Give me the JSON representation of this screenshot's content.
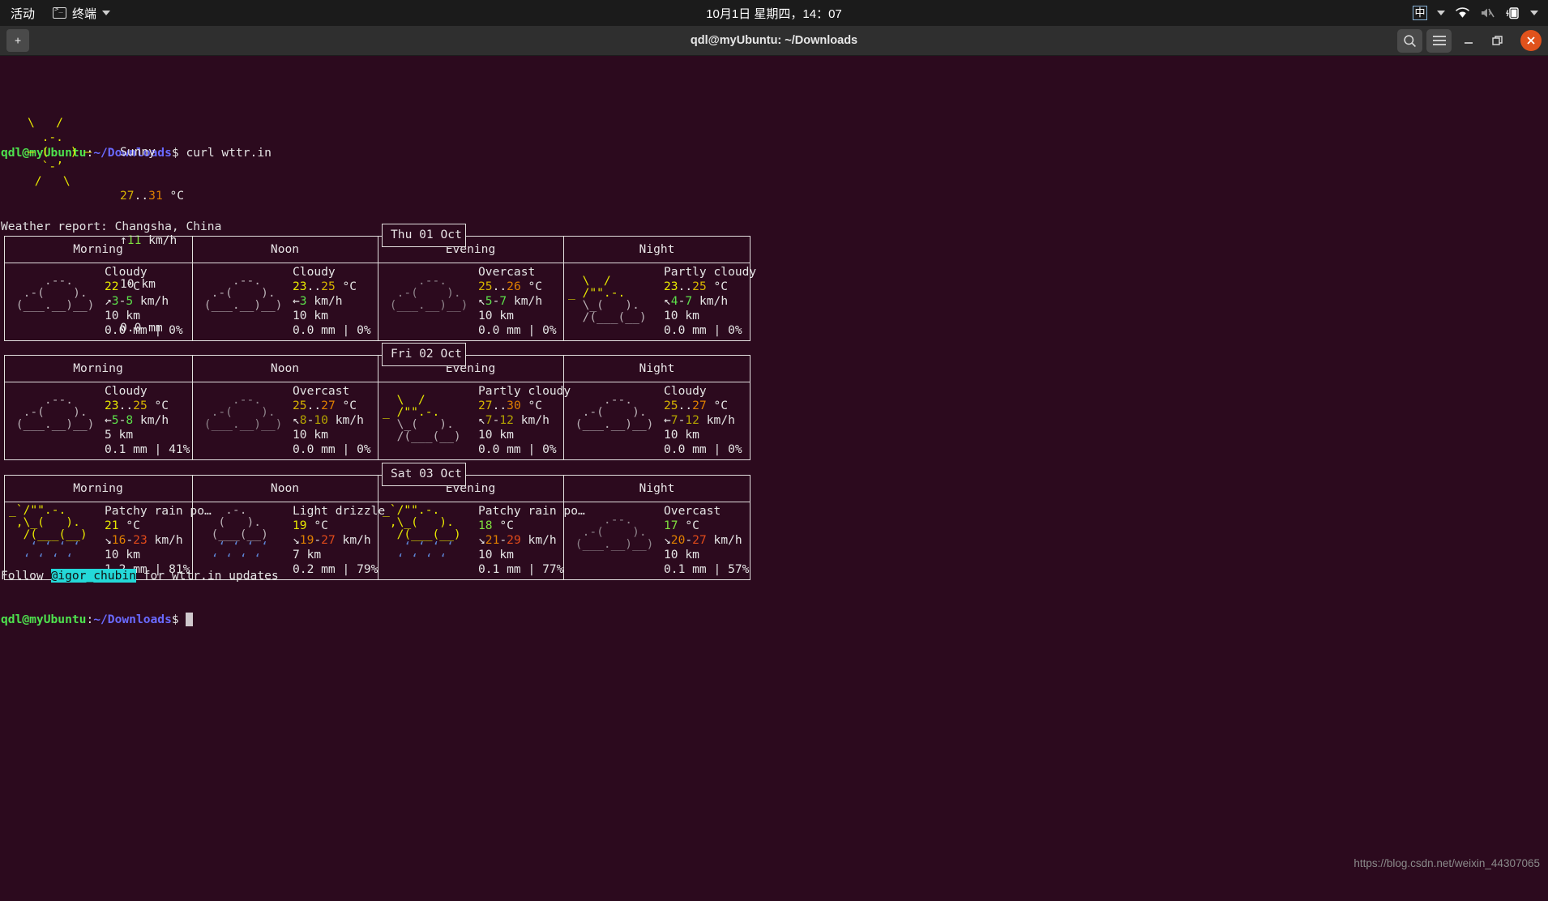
{
  "topbar": {
    "activities": "活动",
    "app_menu": "终端",
    "clock": "10月1日 星期四，14：07",
    "ime": "中",
    "icons": [
      "terminal-icon",
      "chevron-down-icon",
      "wifi-icon",
      "volume-muted-icon",
      "battery-icon",
      "chevron-down-icon"
    ]
  },
  "window": {
    "title": "qdl@myUbuntu: ~/Downloads",
    "new_tab": "+",
    "search": "⌕",
    "menu": "☰",
    "minimize": "—",
    "maximize": "❐",
    "close": "✕"
  },
  "terminal": {
    "prompt_user": "qdl@myUbuntu",
    "prompt_colon": ":",
    "prompt_path": "~/Downloads",
    "prompt_sym": "$ ",
    "command": "curl wttr.in",
    "report_line": "Weather report: Changsha, China",
    "footer_pre": "Follow ",
    "footer_handle": "@igor_chubin",
    "footer_post": " for wttr.in updates"
  },
  "current": {
    "art": [
      "\\   /",
      "  .-.",
      "― (   ) ―",
      "  `-’",
      " /   \\"
    ],
    "condition": "Sunny",
    "temp_lo": "27",
    "temp_sep": "..",
    "temp_hi": "31",
    "temp_unit": " °C",
    "wind_arrow": "↑",
    "wind": "11",
    "wind_unit": " km/h",
    "visibility": "10 km",
    "precip": "0.0 mm"
  },
  "columns": [
    "Morning",
    "Noon",
    "Evening",
    "Night"
  ],
  "days": [
    {
      "label": "Thu 01 Oct",
      "cells": [
        {
          "art": [
            "     .--.",
            "  .-(    ).",
            " (___.__)__)"
          ],
          "art_color": "gray",
          "condition": "Cloudy",
          "temp": "22",
          "temp2": "",
          "unit": " °C",
          "arrow": "↗",
          "wind_lo": "3",
          "wind_sep": "-",
          "wind_hi": "5",
          "wind_unit": " km/h",
          "vis": "10 km",
          "precip": "0.0 mm | 0%",
          "temp_cls": "yellow",
          "wind_cls": "green"
        },
        {
          "art": [
            "     .--.",
            "  .-(    ).",
            " (___.__)__)"
          ],
          "art_color": "gray",
          "condition": "Cloudy",
          "temp": "23",
          "temp2": "25",
          "unit": " °C",
          "arrow": "←",
          "wind_lo": "3",
          "wind_sep": "",
          "wind_hi": "",
          "wind_unit": " km/h",
          "vis": "10 km",
          "precip": "0.0 mm | 0%",
          "temp_cls": "yellow",
          "wind_cls": "green"
        },
        {
          "art": [
            "     .--.",
            "  .-(    ).",
            " (___.__)__)"
          ],
          "art_color": "dim",
          "condition": "Overcast",
          "temp": "25",
          "temp2": "26",
          "unit": " °C",
          "arrow": "↖",
          "wind_lo": "5",
          "wind_sep": "-",
          "wind_hi": "7",
          "wind_unit": " km/h",
          "vis": "10 km",
          "precip": "0.0 mm | 0%",
          "temp_cls": "ylw2",
          "wind_cls": "green"
        },
        {
          "art": [
            "  \\  /",
            "_ /\"\".-.",
            "  \\_(   ).",
            "  /(___(__)"
          ],
          "art_color": "sun",
          "condition": "Partly cloudy",
          "temp": "23",
          "temp2": "25",
          "unit": " °C",
          "arrow": "↖",
          "wind_lo": "4",
          "wind_sep": "-",
          "wind_hi": "7",
          "wind_unit": " km/h",
          "vis": "10 km",
          "precip": "0.0 mm | 0%",
          "temp_cls": "yellow",
          "wind_cls": "green"
        }
      ]
    },
    {
      "label": "Fri 02 Oct",
      "cells": [
        {
          "art": [
            "     .--.",
            "  .-(    ).",
            " (___.__)__)"
          ],
          "art_color": "gray",
          "condition": "Cloudy",
          "temp": "23",
          "temp2": "25",
          "unit": " °C",
          "arrow": "←",
          "wind_lo": "5",
          "wind_sep": "-",
          "wind_hi": "8",
          "wind_unit": " km/h",
          "vis": "5 km",
          "precip": "0.1 mm | 41%",
          "temp_cls": "yellow",
          "wind_cls": "green"
        },
        {
          "art": [
            "     .--.",
            "  .-(    ).",
            " (___.__)__)"
          ],
          "art_color": "dim",
          "condition": "Overcast",
          "temp": "25",
          "temp2": "27",
          "unit": " °C",
          "arrow": "↖",
          "wind_lo": "8",
          "wind_sep": "-",
          "wind_hi": "10",
          "wind_unit": " km/h",
          "vis": "10 km",
          "precip": "0.0 mm | 0%",
          "temp_cls": "ylw2",
          "wind_cls": "olive"
        },
        {
          "art": [
            "  \\  /",
            "_ /\"\".-.",
            "  \\_(   ).",
            "  /(___(__)"
          ],
          "art_color": "sun",
          "condition": "Partly cloudy",
          "temp": "27",
          "temp2": "30",
          "unit": " °C",
          "arrow": "↖",
          "wind_lo": "7",
          "wind_sep": "-",
          "wind_hi": "12",
          "wind_unit": " km/h",
          "vis": "10 km",
          "precip": "0.0 mm | 0%",
          "temp_cls": "ylw2",
          "wind_cls": "olive"
        },
        {
          "art": [
            "     .--.",
            "  .-(    ).",
            " (___.__)__)"
          ],
          "art_color": "gray",
          "condition": "Cloudy",
          "temp": "25",
          "temp2": "27",
          "unit": " °C",
          "arrow": "←",
          "wind_lo": "7",
          "wind_sep": "-",
          "wind_hi": "12",
          "wind_unit": " km/h",
          "vis": "10 km",
          "precip": "0.0 mm | 0%",
          "temp_cls": "ylw2",
          "wind_cls": "olive"
        }
      ]
    },
    {
      "label": "Sat 03 Oct",
      "cells": [
        {
          "art": [
            "_`/\"\".-.",
            " ,\\_(   ).",
            "  /(___(__)",
            "   ‘ ‘ ‘ ‘",
            "  ‘ ‘ ‘ ‘"
          ],
          "art_color": "rain",
          "condition": "Patchy rain po…",
          "temp": "21",
          "temp2": "",
          "unit": " °C",
          "arrow": "↘",
          "wind_lo": "16",
          "wind_sep": "-",
          "wind_hi": "23",
          "wind_unit": " km/h",
          "vis": "10 km",
          "precip": "1.2 mm | 81%",
          "temp_cls": "yellow",
          "wind_cls": "orange"
        },
        {
          "art": [
            "    .-.",
            "   (   ).",
            "  (___(__)",
            "   ‘ ‘ ‘ ‘",
            "  ‘ ‘ ‘ ‘"
          ],
          "art_color": "rain2",
          "condition": "Light drizzle",
          "temp": "19",
          "temp2": "",
          "unit": " °C",
          "arrow": "↘",
          "wind_lo": "19",
          "wind_sep": "-",
          "wind_hi": "27",
          "wind_unit": " km/h",
          "vis": "7 km",
          "precip": "0.2 mm | 79%",
          "temp_cls": "yellow",
          "wind_cls": "orange"
        },
        {
          "art": [
            "_`/\"\".-.",
            " ,\\_(   ).",
            "  /(___(__)",
            "   ‘ ‘ ‘ ‘",
            "  ‘ ‘ ‘ ‘"
          ],
          "art_color": "rain",
          "condition": "Patchy rain po…",
          "temp": "18",
          "temp2": "",
          "unit": " °C",
          "arrow": "↘",
          "wind_lo": "21",
          "wind_sep": "-",
          "wind_hi": "29",
          "wind_unit": " km/h",
          "vis": "10 km",
          "precip": "0.1 mm | 77%",
          "temp_cls": "lgreen",
          "wind_cls": "orange"
        },
        {
          "art": [
            "     .--.",
            "  .-(    ).",
            " (___.__)__)"
          ],
          "art_color": "dim",
          "condition": "Overcast",
          "temp": "17",
          "temp2": "",
          "unit": " °C",
          "arrow": "↘",
          "wind_lo": "20",
          "wind_sep": "-",
          "wind_hi": "27",
          "wind_unit": " km/h",
          "vis": "10 km",
          "precip": "0.1 mm | 57%",
          "temp_cls": "lgreen",
          "wind_cls": "orange"
        }
      ]
    }
  ],
  "watermark": "https://blog.csdn.net/weixin_44307065",
  "colors": {
    "terminal_bg": "#2c0a1e",
    "prompt_green": "#4ee24e",
    "prompt_blue": "#6a6aff",
    "accent_close": "#e0521c",
    "highlight_cyan": "#24d8d8"
  }
}
